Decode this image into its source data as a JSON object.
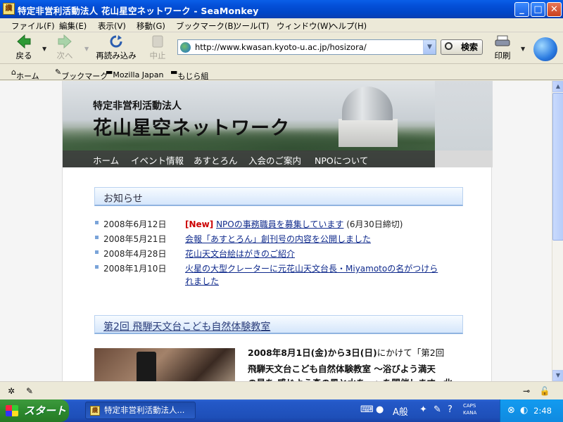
{
  "window": {
    "title": "特定非営利活動法人 花山星空ネットワーク - SeaMonkey",
    "app_icon": "纜",
    "controls": {
      "minimize": "_",
      "maximize": "□",
      "close": "✕"
    }
  },
  "menu": [
    "ファイル(F)",
    "編集(E)",
    "表示(V)",
    "移動(G)",
    "ブックマーク(B)",
    "ツール(T)",
    "ウィンドウ(W)",
    "ヘルプ(H)"
  ],
  "nav": {
    "back": "戻る",
    "forward": "次へ",
    "reload": "再読み込み",
    "stop": "中止",
    "url": "http://www.kwasan.kyoto-u.ac.jp/hosizora/",
    "search": "検索",
    "print": "印刷"
  },
  "bookmarks": [
    "ホーム",
    "ブックマーク",
    "Mozilla Japan",
    "もじら組"
  ],
  "site": {
    "org": "特定非営利活動法人",
    "name": "花山星空ネットワーク",
    "nav": [
      "ホーム",
      "イベント情報",
      "あすとろん",
      "入会のご案内",
      "NPOについて"
    ]
  },
  "news": {
    "heading": "お知らせ",
    "items": [
      {
        "date": "2008年6月12日",
        "badge": "[New]",
        "title": "NPOの事務職員を募集しています",
        "note": "(6月30日締切)"
      },
      {
        "date": "2008年5月21日",
        "title": "会報「あすとろん」創刊号の内容を公開しました"
      },
      {
        "date": "2008年4月28日",
        "title": "花山天文台絵はがきのご紹介"
      },
      {
        "date": "2008年1月10日",
        "title": "火星の大型クレーターに元花山天文台長・Miyamotoの名がつけら",
        "title_cont": "れました"
      }
    ]
  },
  "event": {
    "heading": "第2回 飛騨天文台こども自然体験教室",
    "line1_a": "2008年8月1日(金)から3日(日)",
    "line1_b": "にかけて「第2回",
    "line2": "飛騨天文台こども自然体験教室 ～浴びよう満天",
    "line3": "の星を 感じよう森の風と水を～」を開催します。北"
  },
  "taskbar": {
    "start": "スタート",
    "task": "特定非営利活動法人...",
    "ime": "A般",
    "caps": "CAPS",
    "kana": "KANA",
    "clock": "2:48"
  }
}
